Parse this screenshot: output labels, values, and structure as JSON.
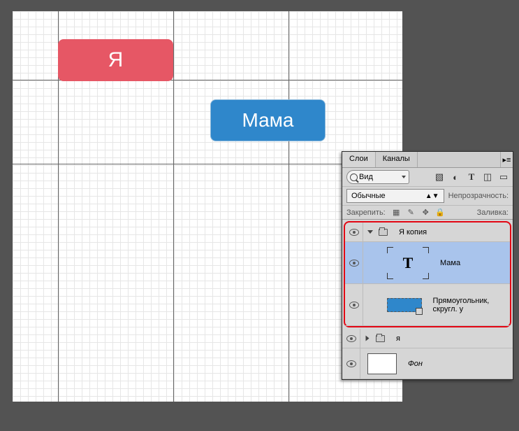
{
  "canvas": {
    "red_label": "Я",
    "blue_label": "Мама"
  },
  "panel": {
    "tabs": {
      "layers": "Слои",
      "channels": "Каналы"
    },
    "search": {
      "label": "Вид"
    },
    "icons": {
      "img": "image",
      "adjust": "adjust",
      "text": "T",
      "transform": "transform",
      "mask": "mask"
    },
    "mode": {
      "value": "Обычные",
      "opacity_label": "Непрозрачность:"
    },
    "lock": {
      "label": "Закрепить:",
      "fill_label": "Заливка:"
    },
    "layers": {
      "group_name": "Я копия",
      "text_layer_name": "Мама",
      "shape_layer_name": "Прямоугольник, скругл. у",
      "group2_name": "я",
      "bg_name": "Фон"
    }
  }
}
